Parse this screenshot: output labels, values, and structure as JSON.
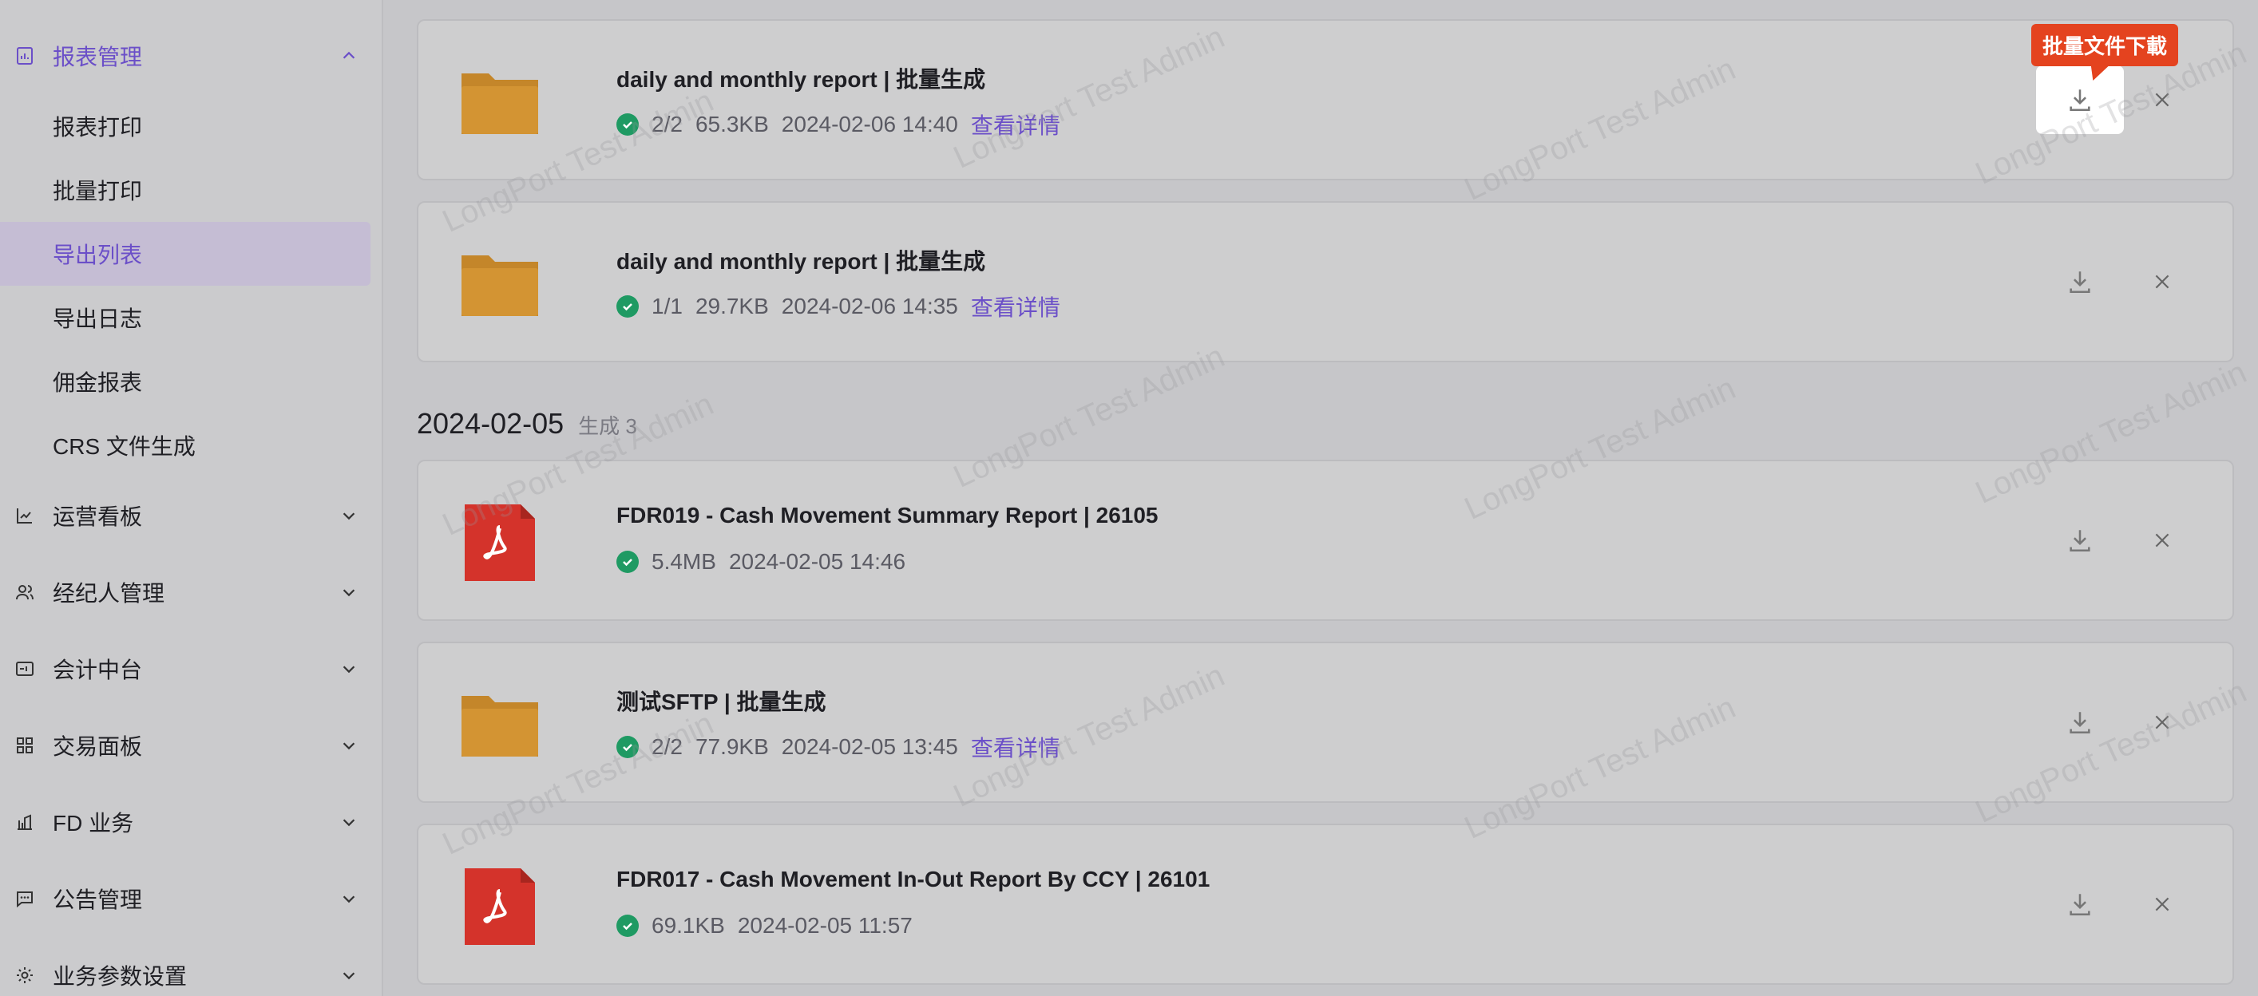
{
  "sidebar": {
    "report_group": {
      "label": "报表管理",
      "icon": "report-icon",
      "expanded": true
    },
    "report_items": [
      {
        "label": "报表打印"
      },
      {
        "label": "批量打印"
      },
      {
        "label": "导出列表",
        "active": true
      },
      {
        "label": "导出日志"
      },
      {
        "label": "佣金报表"
      },
      {
        "label": "CRS 文件生成"
      }
    ],
    "groups": [
      {
        "label": "运营看板",
        "icon": "line-chart-icon"
      },
      {
        "label": "经纪人管理",
        "icon": "users-icon"
      },
      {
        "label": "会计中台",
        "icon": "ledger-icon"
      },
      {
        "label": "交易面板",
        "icon": "dashboard-grid-icon"
      },
      {
        "label": "FD 业务",
        "icon": "bank-icon"
      },
      {
        "label": "公告管理",
        "icon": "message-icon"
      },
      {
        "label": "业务参数设置",
        "icon": "gear-icon"
      }
    ]
  },
  "tooltip": {
    "text": "批量文件下載"
  },
  "date_group": {
    "date": "2024-02-05",
    "count": "生成 3"
  },
  "files": [
    {
      "type": "folder",
      "title": "daily and monthly report | 批量生成",
      "count": "2/2",
      "size": "65.3KB",
      "time": "2024-02-06 14:40",
      "link": "查看详情"
    },
    {
      "type": "folder",
      "title": "daily and monthly report | 批量生成",
      "count": "1/1",
      "size": "29.7KB",
      "time": "2024-02-06 14:35",
      "link": "查看详情"
    },
    {
      "type": "pdf",
      "title": "FDR019 - Cash Movement Summary Report | 26105",
      "size": "5.4MB",
      "time": "2024-02-05 14:46"
    },
    {
      "type": "folder",
      "title": "测试SFTP | 批量生成",
      "count": "2/2",
      "size": "77.9KB",
      "time": "2024-02-05 13:45",
      "link": "查看详情"
    },
    {
      "type": "pdf",
      "title": "FDR017 - Cash Movement In-Out Report By CCY | 26101",
      "size": "69.1KB",
      "time": "2024-02-05 11:57"
    }
  ],
  "watermark": "LongPort Test Admin",
  "colors": {
    "accent": "#6b4fc8",
    "success": "#1f9a63",
    "folder": "#c4862a",
    "pdf": "#d4332b",
    "tooltip": "#e4431f"
  }
}
